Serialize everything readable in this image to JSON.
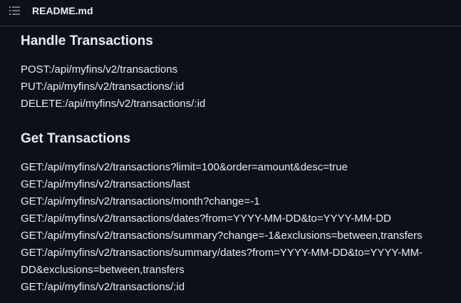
{
  "header": {
    "toc_icon": "list-unordered-icon",
    "file_name": "README.md"
  },
  "sections": [
    {
      "heading": "Handle Transactions",
      "lines": [
        "POST:/api/myfins/v2/transactions",
        "PUT:/api/myfins/v2/transactions/:id",
        "DELETE:/api/myfins/v2/transactions/:id"
      ]
    },
    {
      "heading": "Get Transactions",
      "lines": [
        "GET:/api/myfins/v2/transactions?limit=100&order=amount&desc=true",
        "GET:/api/myfins/v2/transactions/last",
        "GET:/api/myfins/v2/transactions/month?change=-1",
        "GET:/api/myfins/v2/transactions/dates?from=YYYY-MM-DD&to=YYYY-MM-DD",
        "GET:/api/myfins/v2/transactions/summary?change=-1&exclusions=between,transfers",
        "GET:/api/myfins/v2/transactions/summary/dates?from=YYYY-MM-DD&to=YYYY-MM-",
        "DD&exclusions=between,transfers",
        "GET:/api/myfins/v2/transactions/:id"
      ]
    }
  ]
}
